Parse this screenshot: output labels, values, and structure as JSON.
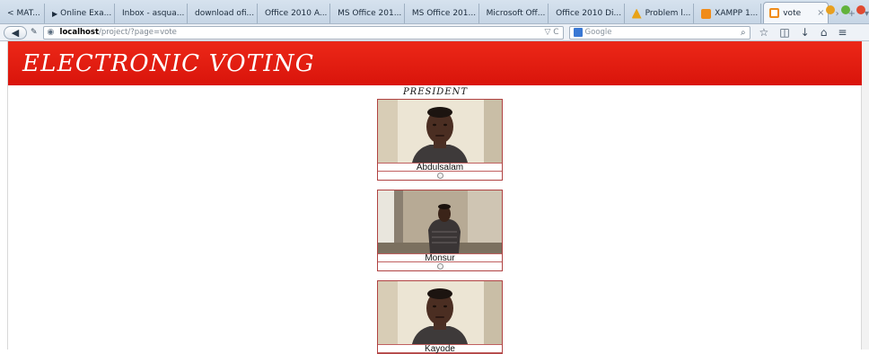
{
  "browser": {
    "tabs": [
      {
        "label": "MAT...",
        "prefix": "<",
        "icon_color": "#6f7f8f"
      },
      {
        "label": "Online Exa...",
        "prefix": "▶",
        "icon_color": "#6f7f8f"
      },
      {
        "label": "Inbox - asqua...",
        "prefix": "",
        "icon_color": "#6f7f8f"
      },
      {
        "label": "download ofi...",
        "prefix": "",
        "icon_color": "#6f7f8f"
      },
      {
        "label": "Office 2010 A...",
        "prefix": "",
        "icon_color": "#6f7f8f"
      },
      {
        "label": "MS Office 201...",
        "prefix": "",
        "icon_color": "#6f7f8f"
      },
      {
        "label": "MS Office 201...",
        "prefix": "",
        "icon_color": "#6f7f8f"
      },
      {
        "label": "Microsoft Off...",
        "prefix": "",
        "icon_color": "#6f7f8f"
      },
      {
        "label": "Office 2010 Di...",
        "prefix": "",
        "icon_color": "#6f7f8f"
      },
      {
        "label": "Problem l...",
        "prefix": "",
        "icon_color": "#e8a317"
      },
      {
        "label": "XAMPP 1...",
        "prefix": "",
        "icon_color": "#f08c1a"
      }
    ],
    "active_tab": {
      "label": "vote",
      "close": "×",
      "icon_color": "#f08c1a"
    },
    "tab_scroll_right": "›",
    "new_tab": "+",
    "tab_list": "▾",
    "url": {
      "host": "localhost",
      "path": "/project/?page=vote",
      "tools": "▽ C"
    },
    "search": {
      "engine_label": "Google",
      "engine_color": "#3a78d4"
    },
    "window_colors": {
      "minimize": "#e8a020",
      "maximize": "#62b33c",
      "close": "#e04a30"
    }
  },
  "page": {
    "banner_title": "ELECTRONIC VOTING",
    "banner_color": "#e3200f",
    "position_title": "PRESIDENT",
    "candidates": [
      {
        "name": "Abdulsalam",
        "photo": "person-headshot"
      },
      {
        "name": "Monsur",
        "photo": "person-standing"
      },
      {
        "name": "Kayode",
        "photo": "person-headshot"
      }
    ]
  }
}
